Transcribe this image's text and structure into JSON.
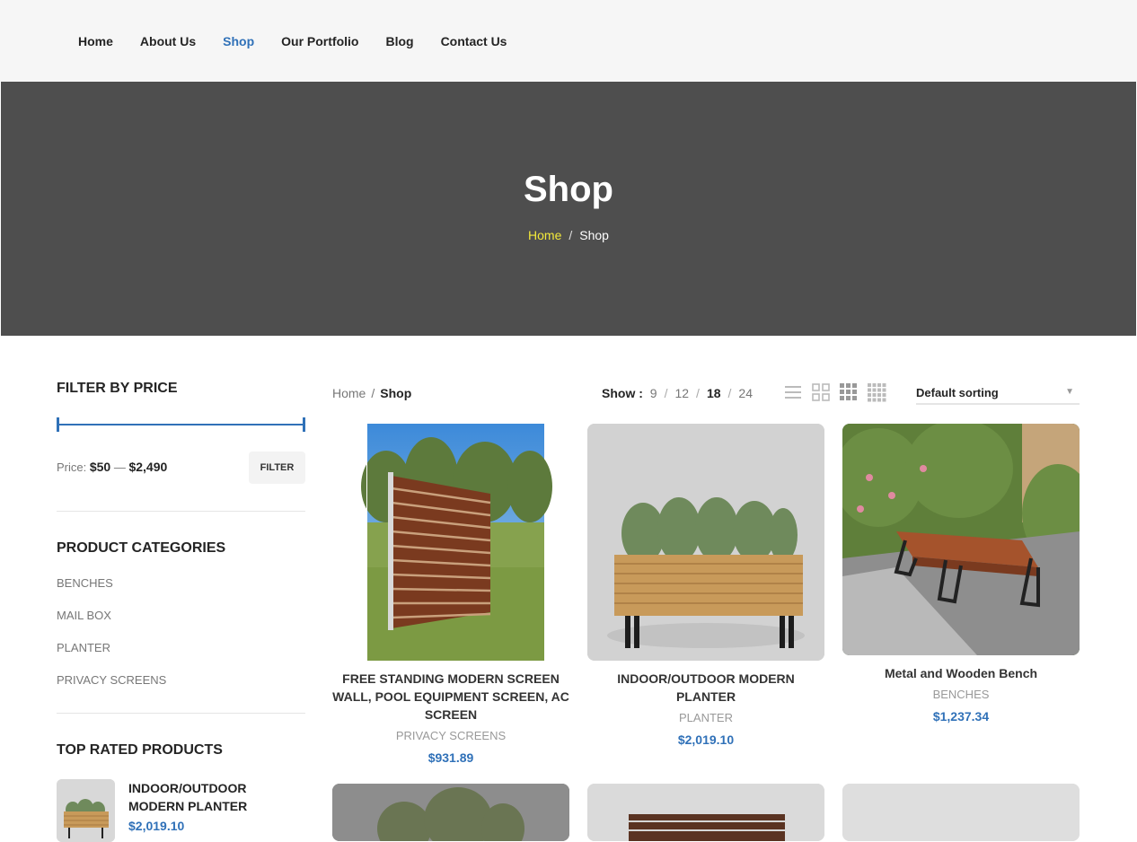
{
  "nav": {
    "items": [
      {
        "label": "Home"
      },
      {
        "label": "About Us"
      },
      {
        "label": "Shop",
        "active": true
      },
      {
        "label": "Our Portfolio"
      },
      {
        "label": "Blog"
      },
      {
        "label": "Contact Us"
      }
    ]
  },
  "hero": {
    "title": "Shop",
    "crumb_home": "Home",
    "crumb_sep": "/",
    "crumb_current": "Shop"
  },
  "sidebar": {
    "price_title": "FILTER BY PRICE",
    "price_label": "Price:",
    "price_min": "$50",
    "price_dash": "—",
    "price_max": "$2,490",
    "filter_label": "FILTER",
    "categories_title": "PRODUCT CATEGORIES",
    "categories": [
      "BENCHES",
      "MAIL BOX",
      "PLANTER",
      "PRIVACY SCREENS"
    ],
    "top_rated_title": "TOP RATED PRODUCTS",
    "top_rated": {
      "name": "INDOOR/OUTDOOR MODERN PLANTER",
      "price": "$2,019.10"
    }
  },
  "toolbar": {
    "crumb_home": "Home",
    "crumb_sep": "/",
    "crumb_current": "Shop",
    "show_label": "Show :",
    "show_options": [
      "9",
      "12",
      "18",
      "24"
    ],
    "show_selected": "18",
    "sort_label": "Default sorting",
    "view_icons": [
      "list-view-icon",
      "grid-2-icon",
      "grid-3-icon",
      "grid-4-icon"
    ]
  },
  "products": [
    {
      "title": "FREE STANDING MODERN SCREEN WALL, POOL EQUIPMENT SCREEN, AC SCREEN",
      "category": "PRIVACY SCREENS",
      "price": "$931.89"
    },
    {
      "title": "INDOOR/OUTDOOR MODERN PLANTER",
      "category": "PLANTER",
      "price": "$2,019.10"
    },
    {
      "title": "Metal and Wooden Bench",
      "category": "BENCHES",
      "price": "$1,237.34"
    }
  ],
  "colors": {
    "accent": "#3071b8",
    "hero_bg": "#4e4e4e",
    "crumb_home": "#f3e93a"
  }
}
